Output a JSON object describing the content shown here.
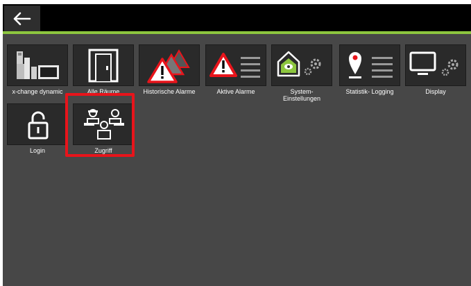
{
  "header": {
    "back_icon": "arrow-left-icon"
  },
  "colors": {
    "accent": "#8dc63f",
    "highlight": "#e8141b",
    "tile_bg": "#2a2a2a",
    "screen_bg": "#474747"
  },
  "tiles": [
    {
      "label": "x-change dynamic",
      "icon": "device-icon"
    },
    {
      "label": "Alle Räume",
      "icon": "door-icon"
    },
    {
      "label": "Historische Alarme",
      "icon": "warning-history-icon"
    },
    {
      "label": "Aktive Alarme",
      "icon": "warning-list-icon"
    },
    {
      "label": "System-",
      "label2": "Einstellungen",
      "icon": "house-gear-icon"
    },
    {
      "label": "Statistik- Logging",
      "icon": "pin-list-icon"
    },
    {
      "label": "Display",
      "icon": "monitor-gear-icon"
    },
    {
      "label": "Login",
      "icon": "lock-icon"
    },
    {
      "label": "Zugriff",
      "icon": "users-access-icon",
      "selected": true
    }
  ]
}
